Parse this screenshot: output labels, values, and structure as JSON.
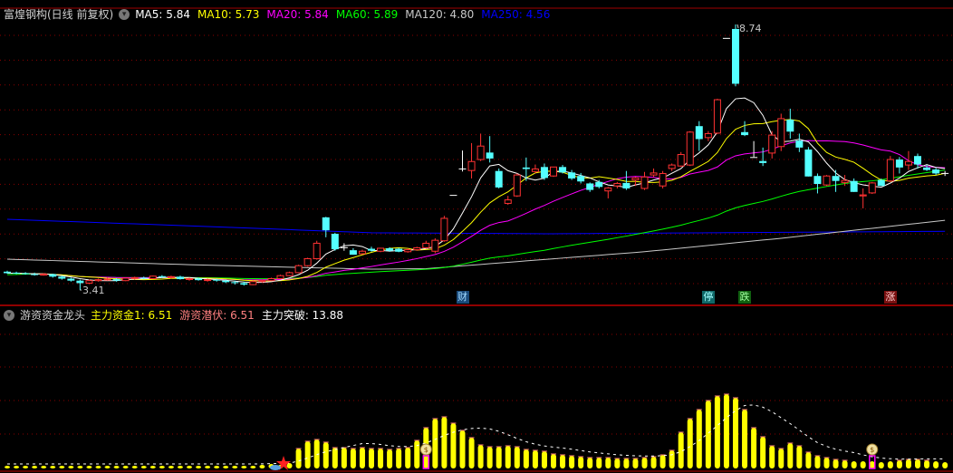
{
  "header": {
    "title": "富煌钢构(日线 前复权)",
    "ma": [
      {
        "label": "MA5: 5.84",
        "color": "#ffffff"
      },
      {
        "label": "MA10: 5.73",
        "color": "#ffff00"
      },
      {
        "label": "MA20: 5.84",
        "color": "#ff00ff"
      },
      {
        "label": "MA60: 5.89",
        "color": "#00ff00"
      },
      {
        "label": "MA120: 4.80",
        "color": "#c8c8c8"
      },
      {
        "label": "MA250: 4.56",
        "color": "#0000ff"
      }
    ]
  },
  "indicator": {
    "name": "游资资金龙头",
    "items": [
      {
        "label": "主力资金1: 6.51",
        "color": "#ffff00"
      },
      {
        "label": "游资潜伏: 6.51",
        "color": "#ff8080"
      },
      {
        "label": "主力突破: 13.88",
        "color": "#ffffff"
      }
    ]
  },
  "labels": {
    "high": "8.74",
    "low": "3.41"
  },
  "markers": [
    {
      "text": "财",
      "index": 50,
      "bg": "#1a4a7a",
      "fg": "#a0d8ff"
    },
    {
      "text": "停",
      "index": 77,
      "bg": "#106868",
      "fg": "#a0ffff"
    },
    {
      "text": "跌",
      "index": 81,
      "bg": "#106010",
      "fg": "#a0ffa0"
    },
    {
      "text": "涨",
      "index": 97,
      "bg": "#7a1010",
      "fg": "#ffd0d0"
    }
  ],
  "chart_data": {
    "type": "candlestick",
    "price_range": [
      3.2,
      8.9
    ],
    "candles": [
      [
        3.78,
        3.8,
        3.74,
        3.75
      ],
      [
        3.76,
        3.78,
        3.73,
        3.75
      ],
      [
        3.75,
        3.77,
        3.72,
        3.73
      ],
      [
        3.73,
        3.76,
        3.7,
        3.72
      ],
      [
        3.72,
        3.75,
        3.7,
        3.73
      ],
      [
        3.73,
        3.74,
        3.66,
        3.68
      ],
      [
        3.68,
        3.7,
        3.62,
        3.64
      ],
      [
        3.64,
        3.66,
        3.58,
        3.6
      ],
      [
        3.6,
        3.62,
        3.41,
        3.55
      ],
      [
        3.55,
        3.62,
        3.53,
        3.6
      ],
      [
        3.6,
        3.64,
        3.58,
        3.62
      ],
      [
        3.62,
        3.66,
        3.6,
        3.63
      ],
      [
        3.63,
        3.65,
        3.58,
        3.6
      ],
      [
        3.6,
        3.66,
        3.59,
        3.65
      ],
      [
        3.65,
        3.68,
        3.62,
        3.66
      ],
      [
        3.66,
        3.68,
        3.63,
        3.64
      ],
      [
        3.64,
        3.7,
        3.63,
        3.69
      ],
      [
        3.69,
        3.71,
        3.65,
        3.67
      ],
      [
        3.67,
        3.7,
        3.64,
        3.68
      ],
      [
        3.68,
        3.7,
        3.62,
        3.63
      ],
      [
        3.63,
        3.66,
        3.6,
        3.64
      ],
      [
        3.64,
        3.66,
        3.6,
        3.61
      ],
      [
        3.61,
        3.64,
        3.58,
        3.62
      ],
      [
        3.62,
        3.64,
        3.58,
        3.6
      ],
      [
        3.6,
        3.62,
        3.55,
        3.57
      ],
      [
        3.57,
        3.6,
        3.52,
        3.55
      ],
      [
        3.55,
        3.58,
        3.5,
        3.52
      ],
      [
        3.52,
        3.6,
        3.51,
        3.58
      ],
      [
        3.58,
        3.62,
        3.56,
        3.6
      ],
      [
        3.6,
        3.66,
        3.59,
        3.64
      ],
      [
        3.64,
        3.72,
        3.63,
        3.7
      ],
      [
        3.7,
        3.78,
        3.69,
        3.76
      ],
      [
        3.76,
        3.92,
        3.75,
        3.9
      ],
      [
        3.9,
        4.06,
        3.88,
        4.04
      ],
      [
        4.04,
        4.4,
        4.02,
        4.35
      ],
      [
        4.87,
        4.88,
        4.47,
        4.61
      ],
      [
        4.54,
        4.56,
        4.2,
        4.23
      ],
      [
        4.27,
        4.35,
        4.2,
        4.27
      ],
      [
        4.21,
        4.25,
        4.12,
        4.12
      ],
      [
        4.14,
        4.22,
        4.12,
        4.19
      ],
      [
        4.24,
        4.28,
        4.18,
        4.2
      ],
      [
        4.19,
        4.26,
        4.17,
        4.25
      ],
      [
        4.25,
        4.27,
        4.18,
        4.2
      ],
      [
        4.24,
        4.26,
        4.17,
        4.18
      ],
      [
        4.18,
        4.25,
        4.16,
        4.22
      ],
      [
        4.22,
        4.28,
        4.2,
        4.26
      ],
      [
        4.26,
        4.4,
        4.24,
        4.35
      ],
      [
        4.19,
        4.45,
        4.15,
        4.41
      ],
      [
        4.4,
        4.9,
        4.38,
        4.85
      ],
      [
        5.32,
        5.32,
        5.32,
        5.32
      ],
      [
        5.85,
        6.21,
        5.79,
        5.85
      ],
      [
        5.81,
        6.36,
        5.65,
        5.99
      ],
      [
        6.03,
        6.55,
        6.0,
        6.3
      ],
      [
        6.17,
        6.5,
        5.97,
        6.05
      ],
      [
        5.8,
        5.85,
        5.45,
        5.47
      ],
      [
        5.15,
        5.3,
        5.12,
        5.22
      ],
      [
        5.3,
        5.75,
        5.28,
        5.72
      ],
      [
        5.87,
        6.07,
        5.6,
        5.84
      ],
      [
        5.79,
        5.93,
        5.75,
        5.84
      ],
      [
        5.88,
        5.95,
        5.62,
        5.66
      ],
      [
        5.7,
        5.88,
        5.68,
        5.88
      ],
      [
        5.88,
        5.92,
        5.75,
        5.77
      ],
      [
        5.77,
        5.82,
        5.62,
        5.65
      ],
      [
        5.7,
        5.76,
        5.55,
        5.59
      ],
      [
        5.55,
        5.57,
        5.38,
        5.42
      ],
      [
        5.58,
        5.62,
        5.45,
        5.48
      ],
      [
        5.4,
        5.48,
        5.25,
        5.46
      ],
      [
        5.5,
        5.58,
        5.45,
        5.55
      ],
      [
        5.56,
        5.8,
        5.42,
        5.45
      ],
      [
        5.62,
        5.68,
        5.5,
        5.66
      ],
      [
        5.45,
        5.78,
        5.42,
        5.68
      ],
      [
        5.72,
        5.85,
        5.68,
        5.76
      ],
      [
        5.5,
        5.8,
        5.45,
        5.75
      ],
      [
        5.85,
        5.95,
        5.8,
        5.92
      ],
      [
        5.9,
        6.18,
        5.88,
        6.13
      ],
      [
        5.92,
        6.6,
        5.9,
        6.58
      ],
      [
        6.7,
        6.8,
        6.2,
        6.44
      ],
      [
        6.47,
        6.6,
        6.4,
        6.55
      ],
      [
        6.56,
        7.25,
        6.54,
        7.23
      ],
      [
        8.47,
        8.47,
        8.47,
        8.47
      ],
      [
        8.65,
        8.74,
        7.5,
        7.55
      ],
      [
        6.58,
        6.8,
        6.5,
        6.52
      ],
      [
        6.08,
        6.4,
        6.08,
        6.08
      ],
      [
        6.0,
        6.27,
        5.9,
        5.96
      ],
      [
        6.16,
        6.6,
        6.05,
        6.52
      ],
      [
        6.29,
        6.95,
        6.2,
        6.85
      ],
      [
        6.83,
        7.05,
        6.45,
        6.59
      ],
      [
        6.41,
        6.55,
        6.18,
        6.27
      ],
      [
        6.23,
        6.28,
        5.69,
        5.69
      ],
      [
        5.7,
        5.75,
        5.35,
        5.54
      ],
      [
        5.52,
        5.72,
        5.5,
        5.7
      ],
      [
        5.7,
        5.82,
        5.38,
        5.6
      ],
      [
        5.57,
        5.72,
        5.5,
        5.61
      ],
      [
        5.6,
        5.65,
        5.38,
        5.38
      ],
      [
        5.3,
        5.45,
        5.05,
        5.32
      ],
      [
        5.36,
        5.58,
        5.34,
        5.56
      ],
      [
        5.62,
        5.65,
        5.5,
        5.5
      ],
      [
        5.6,
        6.1,
        5.58,
        6.03
      ],
      [
        6.03,
        6.08,
        5.75,
        5.87
      ],
      [
        5.92,
        6.2,
        5.82,
        5.99
      ],
      [
        6.1,
        6.15,
        5.85,
        5.93
      ],
      [
        5.87,
        5.92,
        5.8,
        5.82
      ],
      [
        5.83,
        5.86,
        5.72,
        5.75
      ],
      [
        5.76,
        5.8,
        5.7,
        5.76
      ]
    ],
    "ma120": [
      [
        0,
        4.03
      ],
      [
        20,
        3.92
      ],
      [
        40,
        3.83
      ],
      [
        46,
        3.84
      ],
      [
        70,
        4.18
      ],
      [
        85,
        4.45
      ],
      [
        103,
        4.81
      ]
    ],
    "ma250": [
      [
        0,
        4.83
      ],
      [
        20,
        4.7
      ],
      [
        40,
        4.56
      ],
      [
        60,
        4.54
      ],
      [
        103,
        4.59
      ]
    ],
    "indicator_values": [
      3,
      3,
      3,
      3,
      3,
      3,
      3,
      3,
      3,
      3,
      3,
      3,
      3,
      3,
      3,
      3,
      3,
      3,
      3,
      3,
      3,
      3,
      3,
      3,
      3,
      3,
      3,
      3,
      4,
      5,
      4,
      6,
      22,
      30,
      32,
      29,
      23,
      23,
      22,
      23,
      22,
      22,
      21,
      22,
      23,
      31,
      45,
      55,
      57,
      50,
      42,
      34,
      26,
      24,
      24,
      25,
      24,
      21,
      20,
      19,
      16,
      15,
      14,
      13,
      12,
      12,
      12,
      11,
      11,
      11,
      12,
      13,
      15,
      20,
      40,
      55,
      65,
      75,
      80,
      82,
      78,
      65,
      45,
      35,
      25,
      22,
      28,
      25,
      18,
      14,
      12,
      10,
      9,
      8,
      8,
      8,
      7,
      8,
      9,
      10,
      10,
      9,
      8,
      7
    ],
    "signal_icons": [
      46,
      95
    ]
  }
}
